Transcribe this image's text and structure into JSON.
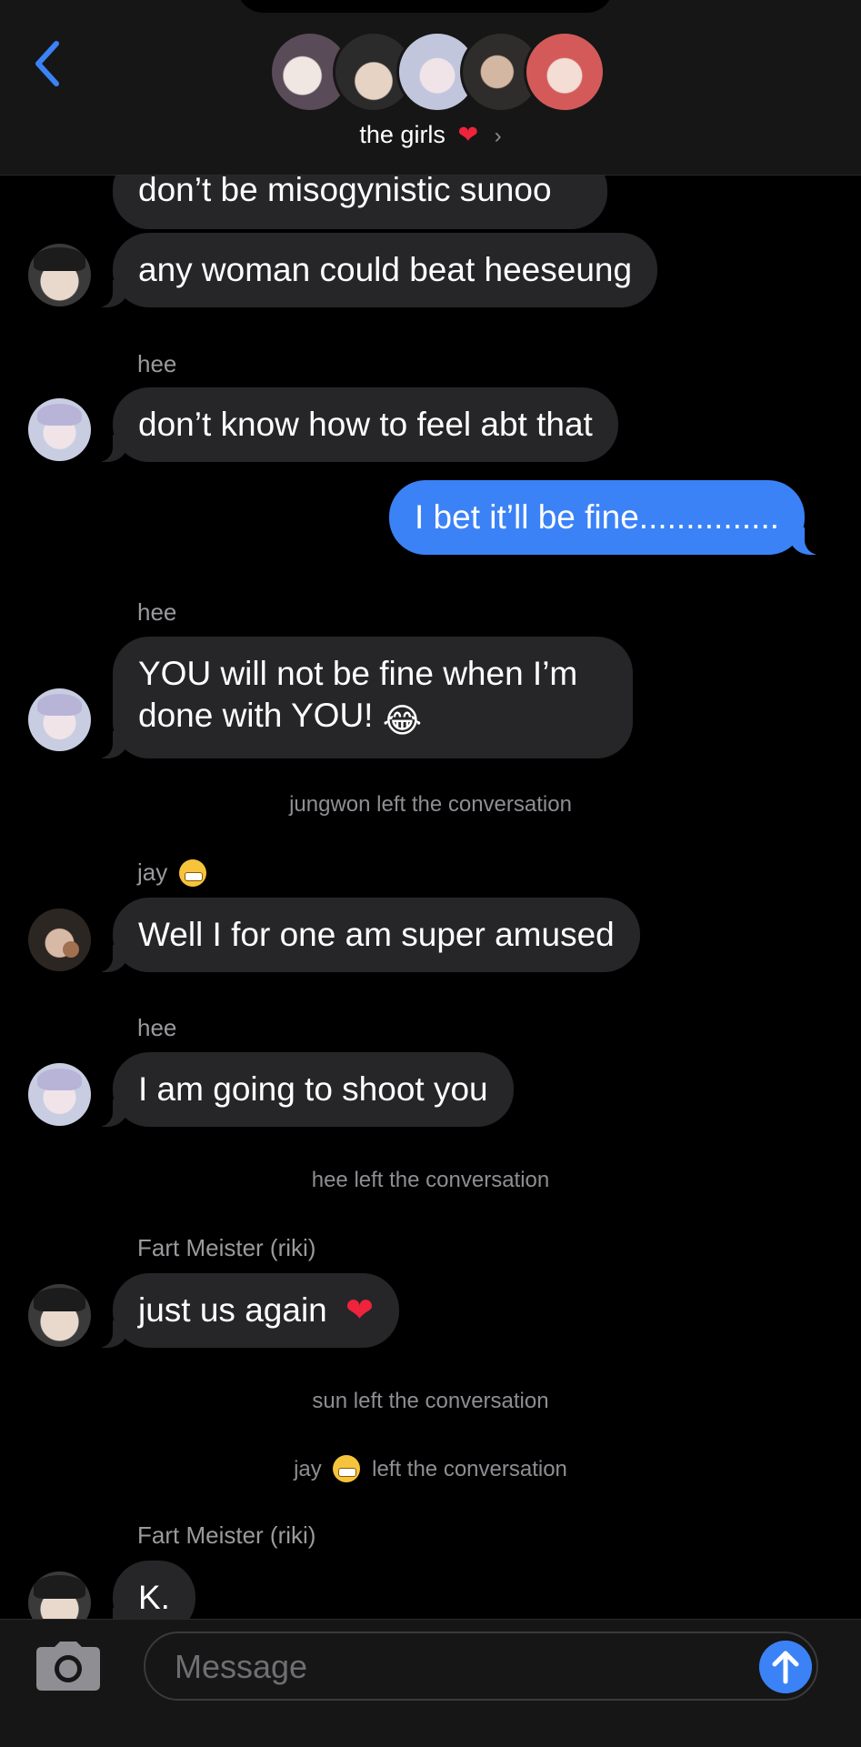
{
  "header": {
    "group_name": "the girls",
    "heart": "❤",
    "chevron": "›",
    "icons": {
      "back": "chevron-left-icon",
      "info": "chevron-right-icon"
    },
    "colors": {
      "accent": "#3b82f6",
      "heart": "#ef233c"
    }
  },
  "thread": {
    "msg1": "don’t be misogynistic sunoo",
    "msg2": "any woman could beat heeseung",
    "sender_hee": "hee",
    "msg3": "don’t know how to feel abt that",
    "msg4_me": "I bet it’ll be fine...............",
    "msg5_line1": "YOU will not be fine when I’m",
    "msg5_line2": "done with YOU!",
    "laugh_emoji": "😂",
    "sys_jungwon": "jungwon left the conversation",
    "sender_jay": "jay",
    "msg6": "Well I for one am super amused",
    "msg7": "I am going to shoot you",
    "sys_hee": "hee left the conversation",
    "sender_riki": "Fart Meister (riki)",
    "msg8": "just us again",
    "heart_emoji": "❤",
    "sys_sun": "sun left the conversation",
    "sys_jay_name": "jay",
    "sys_jay_rest": "left the conversation",
    "msg9": "K."
  },
  "composer": {
    "placeholder": "Message",
    "icons": {
      "camera": "camera-icon",
      "send": "arrow-up-icon"
    }
  }
}
